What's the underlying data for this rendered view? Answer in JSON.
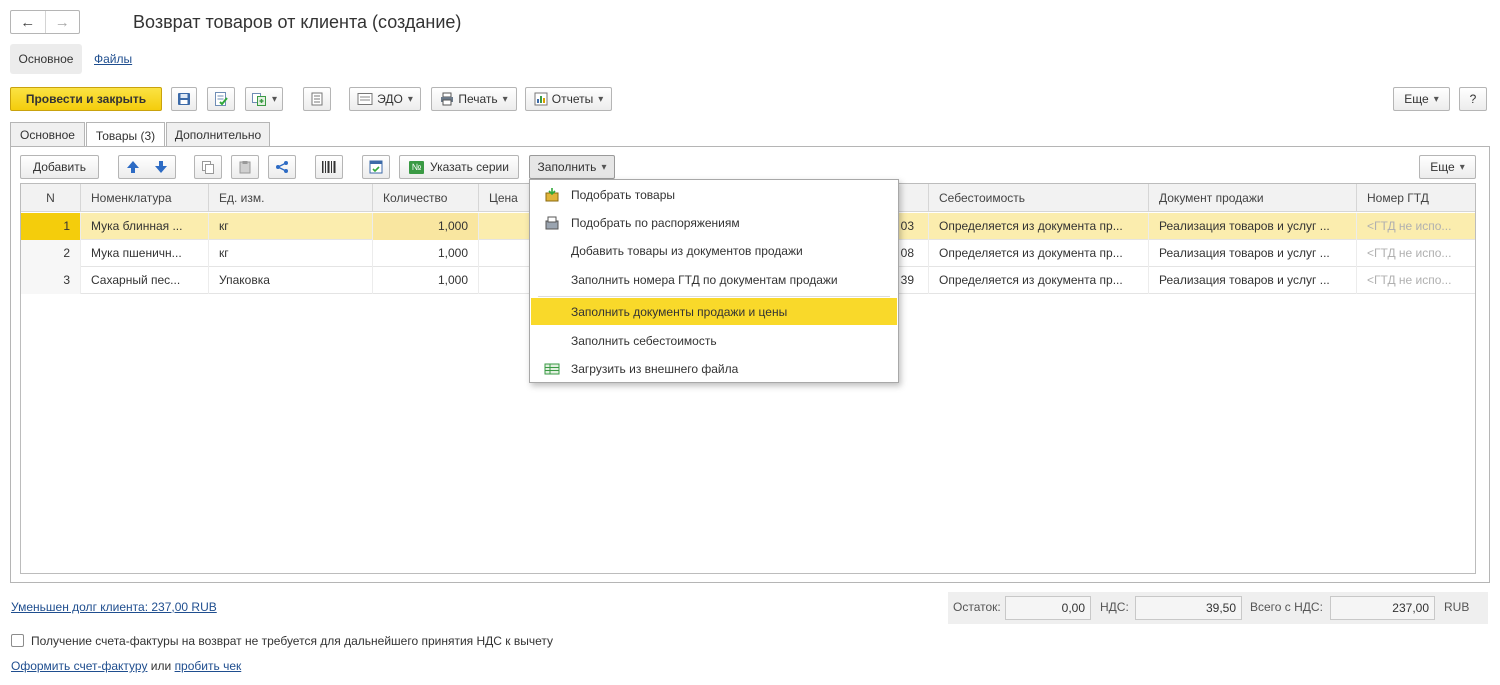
{
  "window": {
    "title": "Возврат товаров от клиента (создание)",
    "back_glyph": "←",
    "forward_glyph": "→"
  },
  "nav": {
    "active": "Основное",
    "files_link": "Файлы"
  },
  "toolbar": {
    "post_close": "Провести и закрыть",
    "edo": "ЭДО",
    "print": "Печать",
    "reports": "Отчеты",
    "more": "Еще",
    "help": "?"
  },
  "tabs": [
    "Основное",
    "Товары (3)",
    "Дополнительно"
  ],
  "table_toolbar": {
    "add": "Добавить",
    "series": "Указать серии",
    "fill": "Заполнить",
    "more": "Еще",
    "series_badge": "№"
  },
  "grid": {
    "columns": [
      "N",
      "Номенклатура",
      "Ед. изм.",
      "Количество",
      "Цена",
      "Себестоимость",
      "Документ продажи",
      "Номер ГТД"
    ],
    "rows": [
      {
        "n": "1",
        "item": "Мука блинная ...",
        "unit": "кг",
        "qty": "1,000",
        "partial": "03",
        "cost": "Определяется из документа пр...",
        "doc": "Реализация товаров и услуг ...",
        "gtd": "<ГТД не испо..."
      },
      {
        "n": "2",
        "item": "Мука пшеничн...",
        "unit": "кг",
        "qty": "1,000",
        "partial": "08",
        "cost": "Определяется из документа пр...",
        "doc": "Реализация товаров и услуг ...",
        "gtd": "<ГТД не испо..."
      },
      {
        "n": "3",
        "item": "Сахарный пес...",
        "unit": "Упаковка",
        "qty": "1,000",
        "partial": "39",
        "cost": "Определяется из документа пр...",
        "doc": "Реализация товаров и услуг ...",
        "gtd": "<ГТД не испо..."
      }
    ]
  },
  "fill_menu": {
    "items": [
      "Подобрать товары",
      "Подобрать по распоряжениям",
      "Добавить товары из документов продажи",
      "Заполнить номера ГТД по документам продажи",
      "Заполнить документы продажи и цены",
      "Заполнить себестоимость",
      "Загрузить из внешнего файла"
    ],
    "highlighted_index": 4
  },
  "footer": {
    "debt_link": "Уменьшен долг клиента: 237,00 RUB",
    "remainder_label": "Остаток:",
    "remainder_value": "0,00",
    "vat_label": "НДС:",
    "vat_value": "39,50",
    "total_label": "Всего с НДС:",
    "total_value": "237,00",
    "currency": "RUB",
    "invoice_checkbox_label": "Получение счета-фактуры на возврат не требуется для дальнейшего принятия НДС к вычету",
    "invoice_checked": false,
    "issue_invoice_link": "Оформить счет-фактуру",
    "or_text": "или",
    "receipt_link": "пробить чек"
  },
  "colors": {
    "accent_yellow": "#f4cd0c",
    "selected_row": "#fbedae",
    "link": "#1f4e8f"
  }
}
